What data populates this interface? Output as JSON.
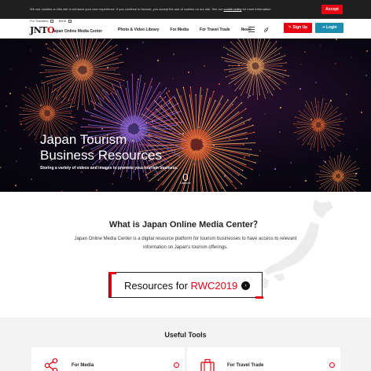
{
  "cookie_bar": {
    "text_before": "We use cookies on this site to enhance your user experience. If you continue to browse, you accept the use of cookies on our site. See our ",
    "link_text": "cookie policy",
    "text_after": " for more information.",
    "accept_label": "Accept"
  },
  "header": {
    "top_links": [
      "For Travelers",
      "MICE"
    ],
    "logo_text": "JNTO",
    "site_name": "Japan Online Media Center",
    "nav": [
      "Photo & Video Library",
      "For Media",
      "For Travel Trade",
      "News"
    ],
    "signup_label": "Sign Up",
    "login_label": "Login"
  },
  "hero": {
    "title_line1": "Japan Tourism",
    "title_line2": "Business Resources",
    "subtitle": "Storing a variety of videos and images to promote your tourism business.",
    "scroll_label": "Discover"
  },
  "what": {
    "title": "What is Japan Online Media Center？",
    "description": "Japan Online Media Center is a digital resource platform for tourism businesses to have access to relevant information on Japan's tourism offerings.",
    "rwc_prefix": "Resources for ",
    "rwc_highlight": "RWC2019"
  },
  "tools": {
    "title": "Useful Tools",
    "cards": [
      {
        "label": "For Media",
        "icon": "share-network-icon"
      },
      {
        "label": "For Travel Trade",
        "icon": "suitcase-icon"
      }
    ]
  },
  "colors": {
    "brand_red": "#e60012",
    "login_blue": "#1e8eb0",
    "cookie_bar_bg": "#1f1f1f"
  }
}
